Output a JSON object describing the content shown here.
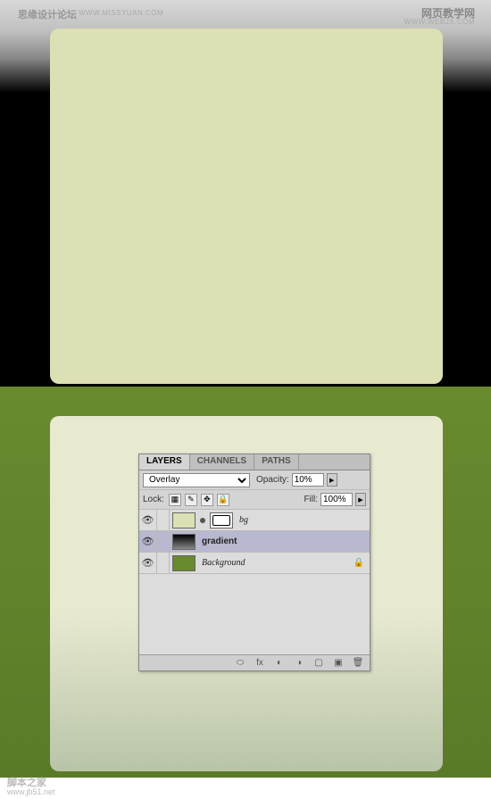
{
  "watermarks": {
    "topLeft": "思缘设计论坛",
    "topLeftSub": "WWW.MISSYUAN.COM",
    "topRight": "网页教学网",
    "topRightSub": "WWW.WEBJX.COM",
    "bottomLeft1": "脚本之家",
    "bottomLeft2": "www.jb51.net"
  },
  "panel": {
    "tabs": {
      "layers": "LAYERS",
      "channels": "CHANNELS",
      "paths": "PATHS"
    },
    "blendMode": "Overlay",
    "opacityLabel": "Opacity:",
    "opacityValue": "10%",
    "lockLabel": "Lock:",
    "fillLabel": "Fill:",
    "fillValue": "100%",
    "layers": [
      {
        "name": "bg"
      },
      {
        "name": "gradient"
      },
      {
        "name": "Background"
      }
    ]
  }
}
